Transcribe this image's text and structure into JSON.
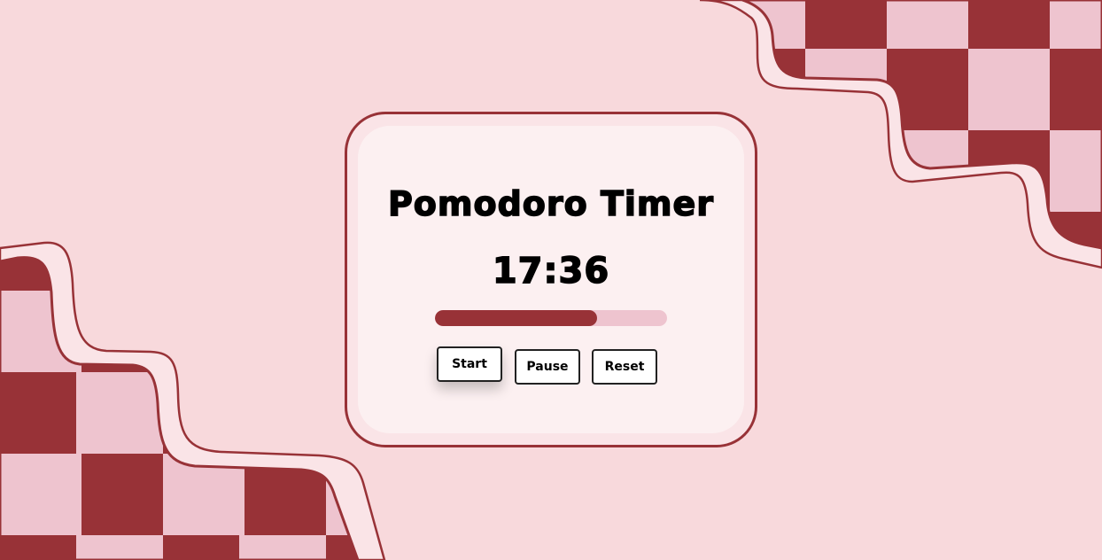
{
  "app": {
    "title": "Pomodoro Timer"
  },
  "timer": {
    "display": "17:36",
    "progress_percent": 70
  },
  "controls": {
    "start_label": "Start",
    "pause_label": "Pause",
    "reset_label": "Reset"
  },
  "colors": {
    "background": "#f8d9dc",
    "accent": "#983237",
    "checker_light": "#eec4cf",
    "card": "#fcf0f1",
    "progress_track": "#eec4cf"
  }
}
